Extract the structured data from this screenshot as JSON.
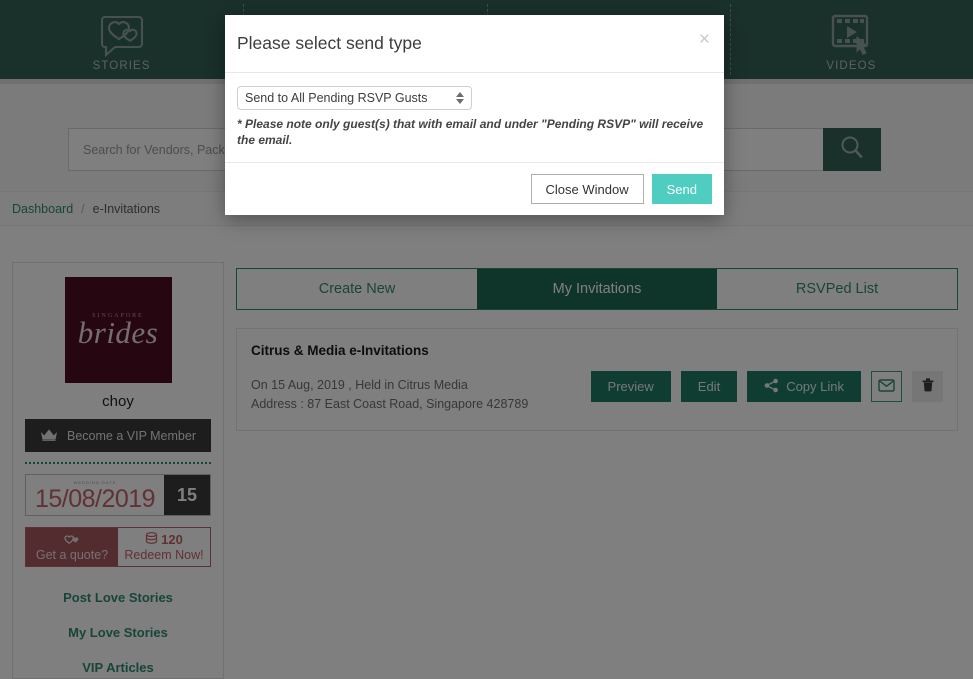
{
  "header": {
    "nav_items": [
      {
        "label": "STORIES",
        "icon": "stories-speech-hearts-icon"
      },
      {
        "label": "",
        "icon": "sparkle-icon"
      },
      {
        "label": "",
        "icon": "frame-icon"
      },
      {
        "label": "VIDEOS",
        "icon": "videos-filmstrip-cursor-icon"
      }
    ]
  },
  "search": {
    "placeholder": "Search for Vendors, Packages, Po",
    "value": "",
    "button_icon": "search-icon"
  },
  "breadcrumb": {
    "root": "Dashboard",
    "separator": "/",
    "current": "e-Invitations"
  },
  "sidebar": {
    "logo_sub": "SINGAPORE",
    "logo_main": "brides",
    "user_name": "choy",
    "vip_button": "Become a VIP Member",
    "vip_icon": "crown-icon",
    "wedding_date_label": "WEDDING DATE",
    "wedding_date": "15/08/2019",
    "days_badge": "15",
    "quote_label": "Get a quote?",
    "quote_icon": "hearts-icon",
    "points": "120",
    "points_icon": "coins-icon",
    "redeem_label": "Redeem Now!",
    "links": [
      {
        "label": "Post Love Stories"
      },
      {
        "label": "My Love Stories"
      },
      {
        "label": "VIP Articles"
      }
    ]
  },
  "main": {
    "tabs": [
      {
        "label": "Create New",
        "active": false
      },
      {
        "label": "My Invitations",
        "active": true
      },
      {
        "label": "RSVPed List",
        "active": false
      }
    ],
    "invitation": {
      "title": "Citrus & Media e-Invitations",
      "date_line": "On 15 Aug, 2019 , Held in Citrus Media",
      "address_line": "Address : 87 East Coast Road, Singapore 428789",
      "preview_label": "Preview",
      "edit_label": "Edit",
      "copy_link_label": "Copy Link",
      "copy_link_icon": "share-icon",
      "email_icon": "envelope-icon",
      "delete_icon": "trash-icon"
    }
  },
  "modal": {
    "title": "Please select send type",
    "close_label": "×",
    "select_value": "Send to All Pending RSVP Gusts",
    "note": "* Please note only guest(s) that with email and under \"Pending RSVP\" will receive the email.",
    "close_button": "Close Window",
    "send_button": "Send"
  },
  "colors": {
    "header_green": "#356155",
    "brand_green": "#2f8a73",
    "active_tab_green": "#1e6b57",
    "button_green": "#1e7a62",
    "send_teal": "#4ecdc0",
    "logo_maroon": "#4d0f23",
    "promo_red": "#a6585f",
    "date_red": "#c2626b"
  }
}
